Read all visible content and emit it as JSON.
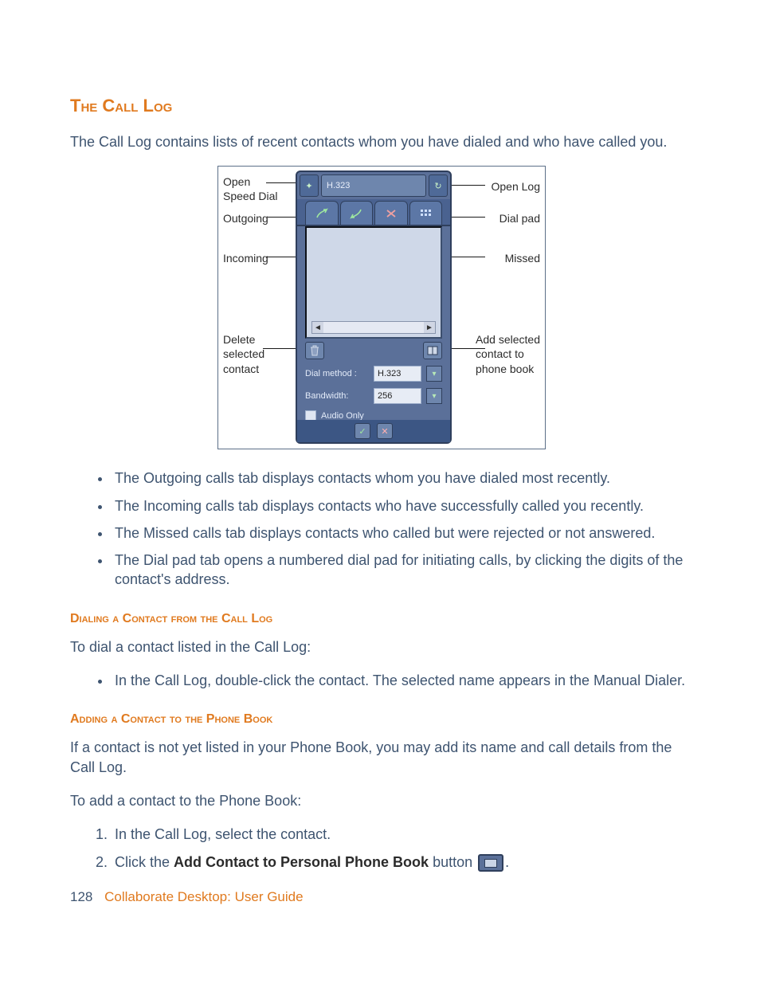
{
  "heading": "The Call Log",
  "intro": "The Call Log contains lists of recent contacts whom you have dialed and who have called you.",
  "figure": {
    "annotations": {
      "open_speed_dial": "Open\nSpeed Dial",
      "outgoing": "Outgoing",
      "incoming": "Incoming",
      "delete_selected": "Delete\nselected\ncontact",
      "open_log": "Open Log",
      "dial_pad": "Dial pad",
      "missed": "Missed",
      "add_selected": "Add selected\ncontact to\nphone book"
    },
    "device": {
      "top_field": "H.323",
      "dial_method_label": "Dial method :",
      "dial_method_value": "H.323",
      "bandwidth_label": "Bandwidth:",
      "bandwidth_value": "256",
      "audio_only_label": "Audio Only"
    }
  },
  "bullets": [
    "The Outgoing calls tab displays contacts whom you have dialed most recently.",
    "The Incoming calls tab displays contacts who have successfully called you recently.",
    "The Missed calls tab displays contacts who called but were rejected or not answered.",
    "The Dial pad tab opens a numbered dial pad for initiating calls, by clicking the digits of the contact's address."
  ],
  "subsec1": {
    "title": "Dialing a Contact from the Call Log",
    "lead": "To dial a contact listed in the Call Log:",
    "item": "In the Call Log, double-click the contact. The selected name appears in the Manual Dialer."
  },
  "subsec2": {
    "title": "Adding a Contact to the Phone Book",
    "p1": "If a contact is not yet listed in your Phone Book, you may add its name and call details from the Call Log.",
    "p2": "To add a contact to the Phone Book:",
    "steps": {
      "s1": "In the Call Log, select the contact.",
      "s2a": "Click the ",
      "s2_bold": "Add Contact to Personal Phone Book",
      "s2b": " button ",
      "s2c": "."
    }
  },
  "footer": {
    "page": "128",
    "guide": "Collaborate Desktop: User Guide"
  }
}
